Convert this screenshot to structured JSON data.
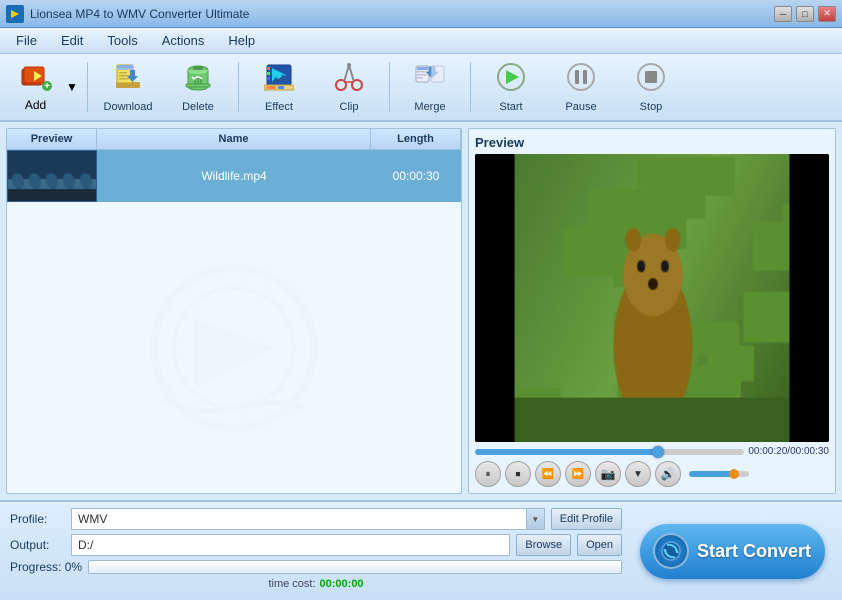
{
  "window": {
    "title": "Lionsea MP4 to WMV Converter Ultimate",
    "controls": [
      "_",
      "□",
      "×"
    ]
  },
  "menu": {
    "items": [
      "File",
      "Edit",
      "Tools",
      "Actions",
      "Help"
    ]
  },
  "toolbar": {
    "add_label": "Add",
    "download_label": "Download",
    "delete_label": "Delete",
    "effect_label": "Effect",
    "clip_label": "Clip",
    "merge_label": "Merge",
    "start_label": "Start",
    "pause_label": "Pause",
    "stop_label": "Stop"
  },
  "filelist": {
    "headers": [
      "Preview",
      "Name",
      "Length"
    ],
    "rows": [
      {
        "name": "Wildlife.mp4",
        "length": "00:00:30"
      }
    ]
  },
  "preview": {
    "title": "Preview",
    "time_current": "00:00:20",
    "time_total": "00:00:30",
    "seek_percent": 68
  },
  "bottom": {
    "profile_label": "Profile:",
    "profile_value": "WMV",
    "edit_profile_label": "Edit Profile",
    "output_label": "Output:",
    "output_value": "D:/",
    "browse_label": "Browse",
    "open_label": "Open",
    "progress_label": "Progress:",
    "progress_value": "0%",
    "progress_percent": 0,
    "time_cost_label": "time cost:",
    "time_cost_value": "00:00:00",
    "start_convert_label": "Start Convert"
  }
}
